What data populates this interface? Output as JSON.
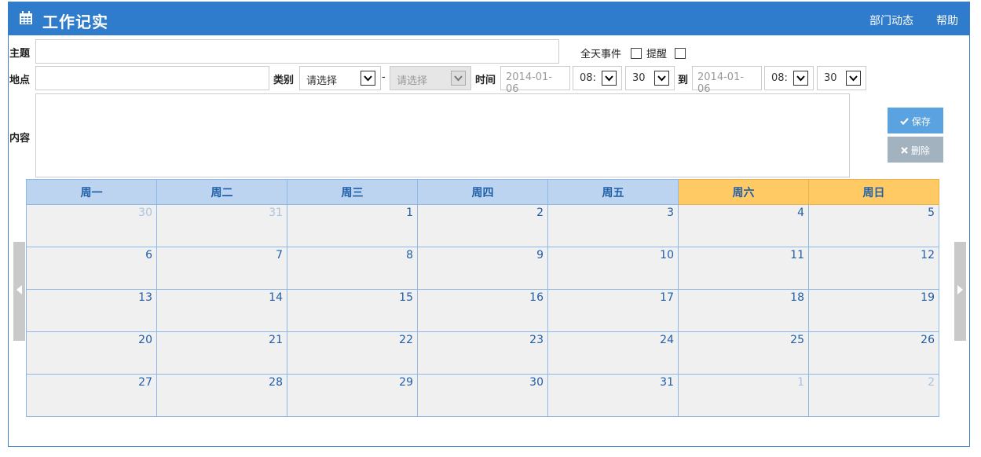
{
  "header": {
    "title": "工作记实",
    "links": [
      "部门动态",
      "帮助"
    ]
  },
  "form": {
    "subject_label": "主题",
    "location_label": "地点",
    "content_label": "内容",
    "allday_label": "全天事件",
    "remind_label": "提醒",
    "category_label": "类别",
    "category_value": "请选择",
    "dash": "-",
    "subcategory_value": "请选择",
    "time_label": "时间",
    "start_date": "2014-01-06",
    "start_hour": "08:",
    "start_min": "30",
    "to_label": "到",
    "end_date": "2014-01-06",
    "end_hour": "08:",
    "end_min": "30"
  },
  "buttons": {
    "save": "保存",
    "delete": "删除"
  },
  "calendar": {
    "weekdays": [
      "周一",
      "周二",
      "周三",
      "周四",
      "周五",
      "周六",
      "周日"
    ],
    "weeks": [
      [
        "30",
        "31",
        "1",
        "2",
        "3",
        "4",
        "5"
      ],
      [
        "6",
        "7",
        "8",
        "9",
        "10",
        "11",
        "12"
      ],
      [
        "13",
        "14",
        "15",
        "16",
        "17",
        "18",
        "19"
      ],
      [
        "20",
        "21",
        "22",
        "23",
        "24",
        "25",
        "26"
      ],
      [
        "27",
        "28",
        "29",
        "30",
        "31",
        "1",
        "2"
      ]
    ]
  },
  "colors": {
    "header": "#2f7ccc",
    "weekday_header": "#bcd4ef",
    "weekend_header": "#ffca64",
    "day_cell": "#f0f0f0"
  }
}
